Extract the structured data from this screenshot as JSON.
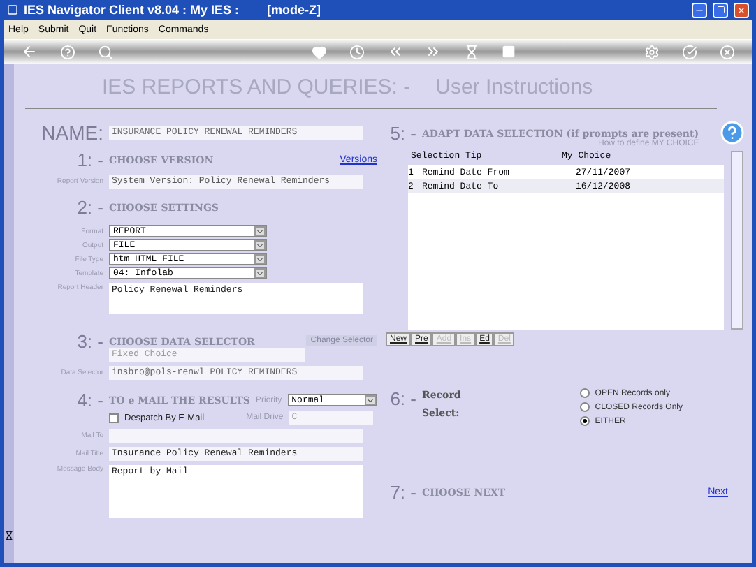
{
  "window": {
    "title": "IES Navigator Client v8.04 : My IES :        [mode-Z]"
  },
  "menu": [
    "Help",
    "Submit",
    "Quit",
    "Functions",
    "Commands"
  ],
  "header": {
    "title": "IES REPORTS AND QUERIES: -",
    "subtitle": "User Instructions"
  },
  "name": {
    "label": "NAME:",
    "value": "INSURANCE POLICY RENEWAL REMINDERS"
  },
  "version": {
    "step": "1: -",
    "heading": "CHOOSE VERSION",
    "link": "Versions",
    "label": "Report Version",
    "value": "System Version: Policy Renewal Reminders"
  },
  "settings": {
    "step": "2: -",
    "heading": "CHOOSE SETTINGS",
    "selects": [
      {
        "label": "Format",
        "value": "REPORT"
      },
      {
        "label": "Output",
        "value": "FILE"
      },
      {
        "label": "File Type",
        "value": "htm HTML FILE"
      },
      {
        "label": "Template",
        "value": "04: Infolab"
      }
    ],
    "header_label": "Report Header",
    "header_value": "Policy Renewal Reminders"
  },
  "selector": {
    "step": "3: -",
    "heading": "CHOOSE DATA SELECTOR",
    "button": "Change Selector",
    "choice": "Fixed Choice",
    "label": "Data Selector",
    "value": "insbro@pols-renwl POLICY REMINDERS"
  },
  "mail": {
    "step": "4: -",
    "heading": "TO e MAIL THE RESULTS",
    "priority_label": "Priority",
    "priority": "Normal",
    "despatch_label": "Despatch By E-Mail",
    "despatch": false,
    "drive_label": "Mail Drive",
    "drive_value": "C",
    "to_label": "Mail To",
    "title_label": "Mail Title",
    "title_value": "Insurance Policy Renewal Reminders",
    "body_label": "Message Body",
    "body_value": "Report by Mail"
  },
  "adapt": {
    "step": "5: -",
    "heading": "ADAPT DATA SELECTION (if prompts are present)",
    "help": "How to define MY CHOICE",
    "columns": [
      "Selection Tip",
      "My Choice"
    ],
    "rows": [
      {
        "num": "1",
        "tip": "Remind Date From",
        "choice": "27/11/2007"
      },
      {
        "num": "2",
        "tip": "Remind Date To",
        "choice": "16/12/2008"
      }
    ],
    "buttons": [
      {
        "label": "New",
        "disabled": false
      },
      {
        "label": "Pre",
        "disabled": false
      },
      {
        "label": "Add",
        "disabled": true
      },
      {
        "label": "Ins",
        "disabled": true
      },
      {
        "label": "Ed",
        "disabled": false
      },
      {
        "label": "Del",
        "disabled": true
      }
    ]
  },
  "record": {
    "step": "6: -",
    "heading": [
      "Record",
      "Select:"
    ],
    "options": [
      {
        "label": "OPEN Records only",
        "selected": false
      },
      {
        "label": "CLOSED Records Only",
        "selected": false
      },
      {
        "label": "EITHER",
        "selected": true
      }
    ]
  },
  "next": {
    "step": "7: -",
    "heading": "CHOOSE NEXT",
    "link": "Next"
  }
}
